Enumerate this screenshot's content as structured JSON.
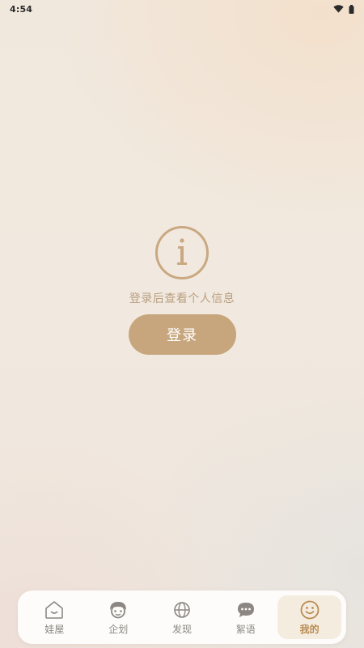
{
  "status_bar": {
    "time": "4:54"
  },
  "main": {
    "info_icon": "info-circle-icon",
    "message": "登录后查看个人信息",
    "login_label": "登录"
  },
  "tabs": [
    {
      "label": "娃屋",
      "icon": "house-icon",
      "active": false
    },
    {
      "label": "企划",
      "icon": "doll-face-icon",
      "active": false
    },
    {
      "label": "发现",
      "icon": "globe-icon",
      "active": false
    },
    {
      "label": "絮语",
      "icon": "chat-bubble-icon",
      "active": false
    },
    {
      "label": "我的",
      "icon": "smiley-icon",
      "active": true
    }
  ],
  "colors": {
    "accent": "#c7a67e",
    "active_tab_text": "#b98c52",
    "inactive_tab_text": "#8c8782"
  }
}
